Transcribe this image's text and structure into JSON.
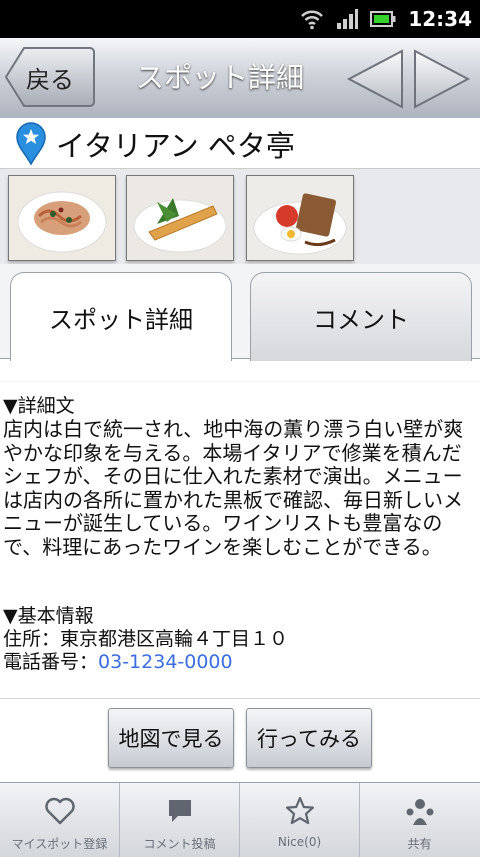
{
  "status": {
    "time": "12:34"
  },
  "nav": {
    "back_label": "戻る",
    "title": "スポット詳細"
  },
  "spot": {
    "name": "イタリアン ペタ亭"
  },
  "photos": [
    "pasta-photo",
    "gratin-photo",
    "appetizer-photo"
  ],
  "tabs": [
    {
      "label": "スポット詳細",
      "active": true
    },
    {
      "label": "コメント",
      "active": false
    }
  ],
  "detail": {
    "desc_heading": "▼詳細文",
    "description": "店内は白で統一され、地中海の薫り漂う白い壁が爽やかな印象を与える。本場イタリアで修業を積んだシェフが、その日に仕入れた素材で演出。メニューは店内の各所に置かれた黒板で確認、毎日新しいメニューが誕生している。ワインリストも豊富なので、料理にあったワインを楽しむことができる。",
    "info_heading": "▼基本情報",
    "address_label": "住所：",
    "address": "東京都港区高輪４丁目１０",
    "phone_label": "電話番号：",
    "phone": "03-1234-0000"
  },
  "actions": {
    "map": "地図で見る",
    "go": "行ってみる"
  },
  "bottom_nav": [
    {
      "label": "マイスポット登録",
      "icon": "heart-icon"
    },
    {
      "label": "コメント投稿",
      "icon": "comment-icon"
    },
    {
      "label": "Nice(0)",
      "icon": "star-icon"
    },
    {
      "label": "共有",
      "icon": "share-icon"
    }
  ],
  "colors": {
    "link": "#3b6de0",
    "pin": "#2b8fe0",
    "titlebar": "#aeb4be"
  }
}
